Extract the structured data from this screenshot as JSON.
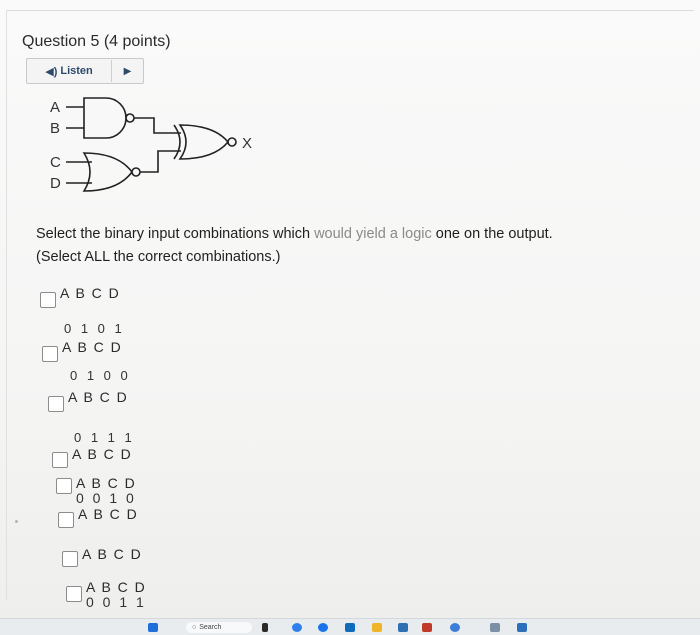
{
  "question": {
    "title": "Question 5 (4 points)"
  },
  "listen": {
    "label": "Listen",
    "speaker_icon": "speaker-icon",
    "play_icon": "play-icon"
  },
  "circuit": {
    "inputs": [
      "A",
      "B",
      "C",
      "D"
    ],
    "output": "X"
  },
  "prompt": {
    "line1_part1": "Select the binary input combinations which ",
    "line1_faded": "would yield a logic",
    "line1_part2": " one on the output.",
    "line2": "(Select ALL the correct combinations.)"
  },
  "options": [
    {
      "header": "A B C D",
      "values": ""
    },
    {
      "header": "A B C D",
      "values": ""
    },
    {
      "header": "A B C D",
      "values": ""
    },
    {
      "header": "A B C D",
      "values": ""
    },
    {
      "header": "A B C D",
      "values": "0 0 1 0"
    },
    {
      "header": "A B C D",
      "values": ""
    },
    {
      "header": "A B C D",
      "values": ""
    },
    {
      "header": "A B C D",
      "values": "0 0 1 1"
    }
  ],
  "loose_values": [
    "0 1 0 1",
    "0 1 0 0",
    "0 1 1 1"
  ],
  "taskbar": {
    "search_label": "Search"
  },
  "colors": {
    "listen_text": "#2e4a6b",
    "prompt_faded": "#8a8a8a"
  }
}
